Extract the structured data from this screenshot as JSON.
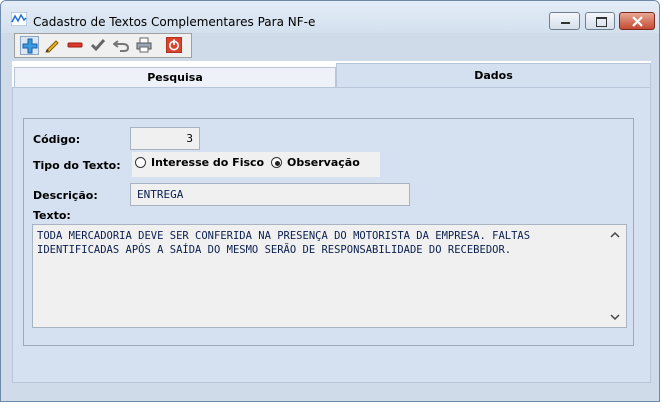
{
  "window": {
    "title": "Cadastro de Textos Complementares Para NF-e",
    "controls": [
      "minimize-icon",
      "maximize-icon",
      "close-icon"
    ]
  },
  "toolbar": {
    "buttons": [
      "add-icon",
      "edit-pencil-icon",
      "remove-icon",
      "confirm-check-icon",
      "undo-icon",
      "print-icon",
      "exit-power-icon"
    ]
  },
  "tabs": [
    {
      "label": "Pesquisa",
      "active": false
    },
    {
      "label": "Dados",
      "active": true
    }
  ],
  "form": {
    "codigo_label": "Código:",
    "codigo_value": "3",
    "tipo_label": "Tipo do Texto:",
    "tipo_options": [
      {
        "label": "Interesse do Fisco",
        "selected": false
      },
      {
        "label": "Observação",
        "selected": true
      }
    ],
    "descricao_label": "Descrição:",
    "descricao_value": "ENTREGA",
    "texto_label": "Texto:",
    "texto_value": "TODA MERCADORIA DEVE SER CONFERIDA NA PRESENÇA DO MOTORISTA DA EMPRESA. FALTAS IDENTIFICADAS APÓS A SAÍDA DO MESMO SERÃO DE RESPONSABILIDADE DO RECEBEDOR."
  },
  "colors": {
    "panel": "#d5e1f1",
    "field": "#f0f0f0",
    "text_value": "#0b1f4f",
    "close_button": "#c54a34"
  }
}
